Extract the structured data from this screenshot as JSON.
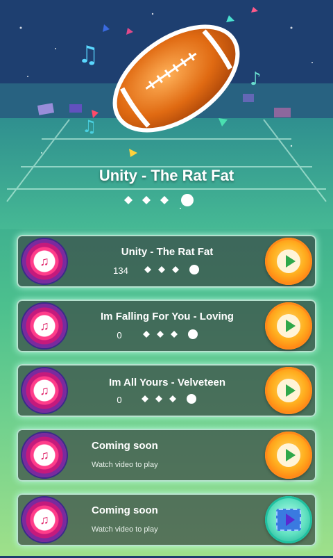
{
  "hero": {
    "song_title": "Unity - The Rat Fat",
    "stars_earned": 0,
    "stars_total": 4
  },
  "songs": [
    {
      "title": "Unity - The Rat Fat",
      "score": "134",
      "locked": false
    },
    {
      "title": "Im Falling For You - Loving",
      "score": "0",
      "locked": false
    },
    {
      "title": "Im All Yours - Velveteen",
      "score": "0",
      "locked": false
    },
    {
      "title": "Coming soon",
      "subtitle": "Watch video to play",
      "locked": true,
      "action": "play"
    },
    {
      "title": "Coming soon",
      "subtitle": "Watch video to play",
      "locked": true,
      "action": "video"
    }
  ],
  "icons": {
    "disc": "music-note-disc-icon",
    "play": "play-icon",
    "video": "video-play-icon",
    "ball": "football-icon"
  },
  "colors": {
    "play_orange": "#ff9a1a",
    "play_green_triangle": "#2fa84a",
    "video_teal": "#21b59a",
    "disc_pink": "#ff3d8a"
  }
}
